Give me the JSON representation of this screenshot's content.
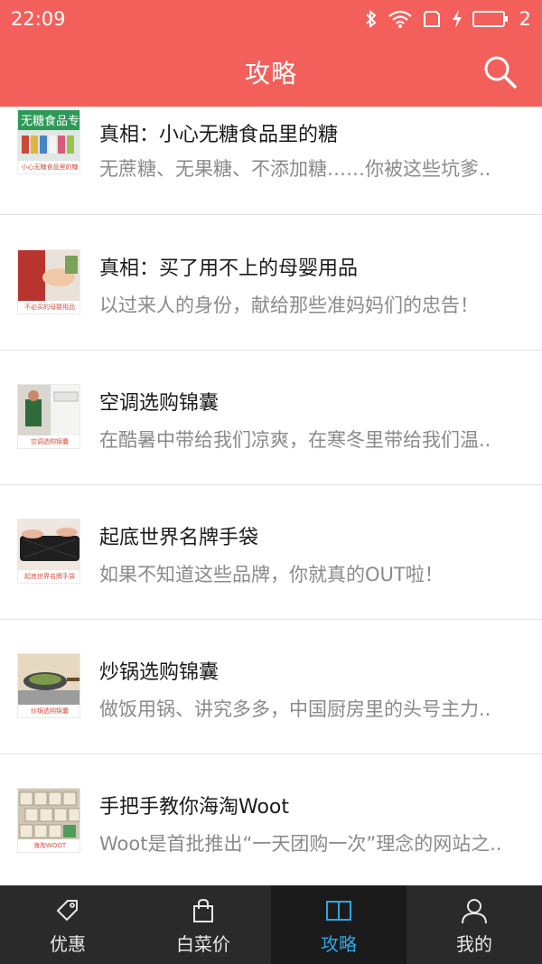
{
  "status_bar": {
    "time": "22:09",
    "battery_level_text": "2"
  },
  "header": {
    "title": "攻略"
  },
  "articles": [
    {
      "title": "真相：小心无糖食品里的糖",
      "desc": "无蔗糖、无果糖、不添加糖……你被这些坑爹..",
      "thumb_caption": "小心无糖食品里的糖",
      "thumb_overlay": "无糖食品专区"
    },
    {
      "title": "真相：买了用不上的母婴用品",
      "desc": "以过来人的身份，献给那些准妈妈们的忠告！",
      "thumb_caption": "不必买的母婴用品"
    },
    {
      "title": "空调选购锦囊",
      "desc": "在酷暑中带给我们凉爽，在寒冬里带给我们温..",
      "thumb_caption": "空调选购锦囊"
    },
    {
      "title": "起底世界名牌手袋",
      "desc": "如果不知道这些品牌，你就真的OUT啦！",
      "thumb_caption": "起底世界名牌手袋"
    },
    {
      "title": "炒锅选购锦囊",
      "desc": "做饭用锅、讲究多多，中国厨房里的头号主力..",
      "thumb_caption": "炒锅选购锦囊"
    },
    {
      "title": "手把手教你海淘Woot",
      "desc": "Woot是首批推出“一天团购一次”理念的网站之..",
      "thumb_caption": "海淘WOOT"
    }
  ],
  "tabs": [
    {
      "label": "优惠",
      "icon": "tag-icon",
      "active": false
    },
    {
      "label": "白菜价",
      "icon": "shopping-bag-icon",
      "active": false
    },
    {
      "label": "攻略",
      "icon": "book-icon",
      "active": true
    },
    {
      "label": "我的",
      "icon": "user-icon",
      "active": false
    }
  ],
  "colors": {
    "brand": "#f3605c",
    "tab_bar_bg": "#2a2a2a",
    "tab_active": "#2ea6e6"
  }
}
